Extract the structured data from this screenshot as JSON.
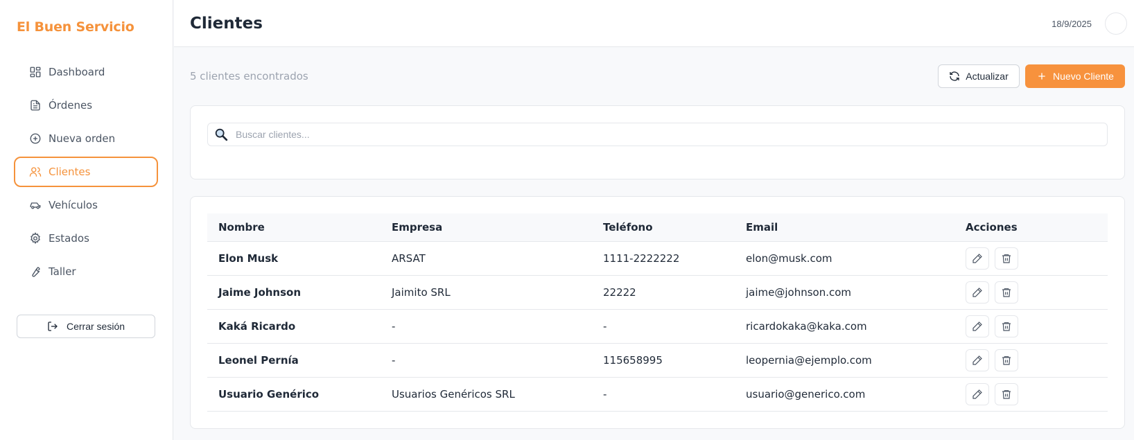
{
  "app": {
    "brand": "El Buen Servicio"
  },
  "sidebar": {
    "items": [
      {
        "label": "Dashboard",
        "icon": "dashboard-icon",
        "active": false
      },
      {
        "label": "Órdenes",
        "icon": "document-icon",
        "active": false
      },
      {
        "label": "Nueva orden",
        "icon": "plus-circle-icon",
        "active": false
      },
      {
        "label": "Clientes",
        "icon": "users-icon",
        "active": true
      },
      {
        "label": "Vehículos",
        "icon": "car-icon",
        "active": false
      },
      {
        "label": "Estados",
        "icon": "gear-icon",
        "active": false
      },
      {
        "label": "Taller",
        "icon": "wrench-icon",
        "active": false
      }
    ],
    "logout_label": "Cerrar sesión"
  },
  "header": {
    "title": "Clientes",
    "date": "18/9/2025"
  },
  "toolbar": {
    "count_text": "5 clientes encontrados",
    "refresh_label": "Actualizar",
    "new_label": "Nuevo Cliente"
  },
  "search": {
    "placeholder": "Buscar clientes...",
    "value": ""
  },
  "table": {
    "columns": [
      "Nombre",
      "Empresa",
      "Teléfono",
      "Email",
      "Acciones"
    ],
    "rows": [
      {
        "nombre": "Elon Musk",
        "empresa": "ARSAT",
        "telefono": "1111-2222222",
        "email": "elon@musk.com"
      },
      {
        "nombre": "Jaime Johnson",
        "empresa": "Jaimito SRL",
        "telefono": "22222",
        "email": "jaime@johnson.com"
      },
      {
        "nombre": "Kaká Ricardo",
        "empresa": "-",
        "telefono": "-",
        "email": "ricardokaka@kaka.com"
      },
      {
        "nombre": "Leonel Pernía",
        "empresa": "-",
        "telefono": "115658995",
        "email": "leopernia@ejemplo.com"
      },
      {
        "nombre": "Usuario Genérico",
        "empresa": "Usuarios Genéricos SRL",
        "telefono": "-",
        "email": "usuario@generico.com"
      }
    ]
  },
  "colors": {
    "accent": "#f5923b",
    "border": "#e5e7eb",
    "muted": "#9ca3af"
  }
}
